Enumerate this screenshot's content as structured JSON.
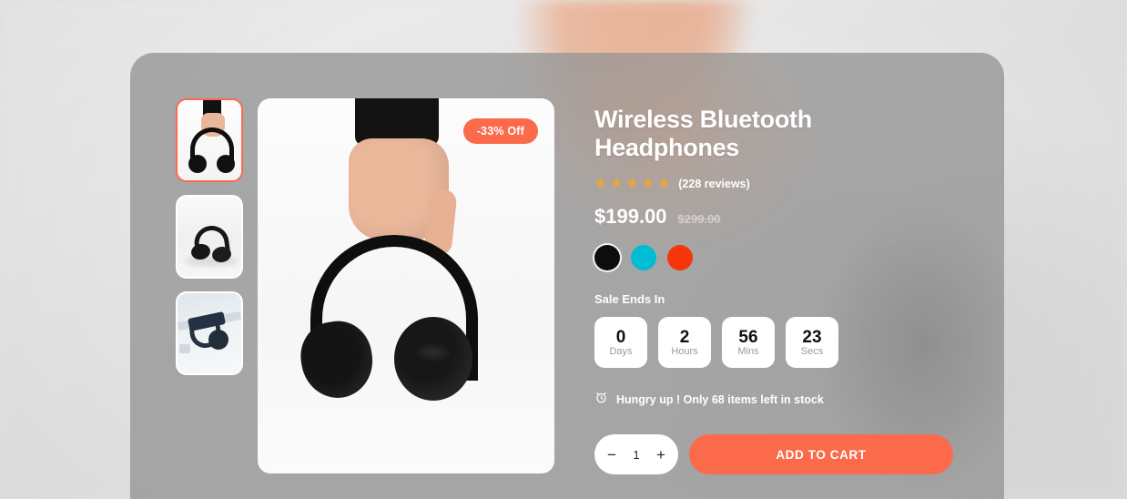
{
  "product": {
    "title": "Wireless Bluetooth Headphones",
    "rating_stars": 5,
    "star_glyph": "★",
    "reviews_label": "(228 reviews)",
    "price_current": "$199.00",
    "price_old": "$299.00",
    "discount_badge": "-33% Off"
  },
  "colors": {
    "options": [
      {
        "name": "black",
        "hex": "#0d0d0d",
        "selected": true
      },
      {
        "name": "cyan",
        "hex": "#00bcd4",
        "selected": false
      },
      {
        "name": "red",
        "hex": "#f5360a",
        "selected": false
      }
    ]
  },
  "sale": {
    "label": "Sale Ends In",
    "countdown": [
      {
        "value": "0",
        "unit": "Days"
      },
      {
        "value": "2",
        "unit": "Hours"
      },
      {
        "value": "56",
        "unit": "Mins"
      },
      {
        "value": "23",
        "unit": "Secs"
      }
    ]
  },
  "stock": {
    "icon": "alarm-clock-icon",
    "message": "Hungry up ! Only 68 items left in stock"
  },
  "cart": {
    "decrement_label": "−",
    "quantity": "1",
    "increment_label": "+",
    "add_to_cart_label": "ADD TO CART"
  },
  "gallery": {
    "thumbnails": [
      {
        "alt": "hand holding black headphones",
        "selected": true
      },
      {
        "alt": "black headphones on white surface",
        "selected": false
      },
      {
        "alt": "navy headphones on desk",
        "selected": false
      }
    ],
    "main_alt": "hand holding black wireless headphones"
  },
  "theme": {
    "accent": "#fa6a4b",
    "star_color": "#f5a623",
    "card_overlay": "rgba(150,150,150,0.80)",
    "page_background": "#e8e8e8"
  }
}
